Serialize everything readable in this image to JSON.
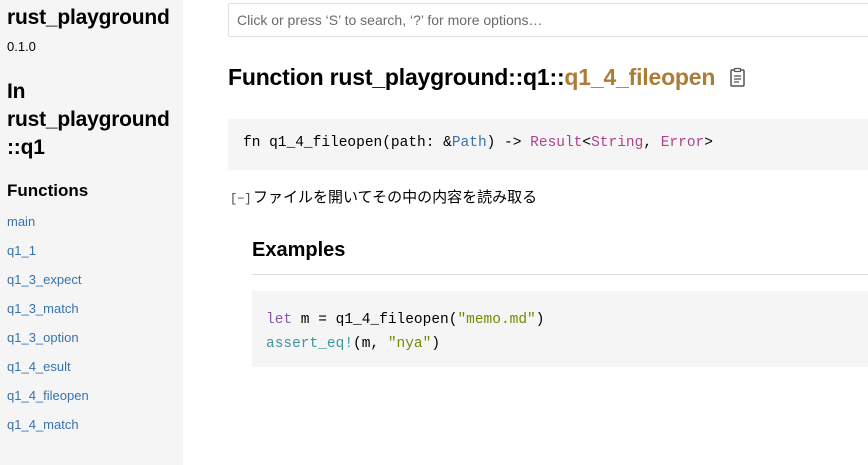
{
  "sidebar": {
    "crate_name": "rust_playground",
    "version": "0.1.0",
    "in_label": "In",
    "in_module_line1": "rust_playground",
    "in_module_line2": "::q1",
    "functions_heading": "Functions",
    "functions": [
      "main",
      "q1_1",
      "q1_3_expect",
      "q1_3_match",
      "q1_3_option",
      "q1_4_esult",
      "q1_4_fileopen",
      "q1_4_match"
    ]
  },
  "search": {
    "placeholder": "Click or press ‘S’ to search, ‘?’ for more options…"
  },
  "main": {
    "title_prefix": "Function rust_playground::q1::",
    "title_fn": "q1_4_fileopen",
    "signature": {
      "fn_kw": "fn q1_4_fileopen(path: &",
      "path_type": "Path",
      "arrow": ") -> ",
      "result_type": "Result",
      "lt": "<",
      "string_type": "String",
      "comma": ", ",
      "error_type": "Error",
      "gt": ">"
    },
    "toggle_label": "[−]",
    "description": "ファイルを開いてその中の内容を読み取る",
    "examples_heading": "Examples",
    "example": {
      "line1_kw": "let",
      "line1_mid": " m = q1_4_fileopen(",
      "line1_str": "\"memo.md\"",
      "line1_end": ")",
      "line2_macro": "assert_eq!",
      "line2_mid": "(m, ",
      "line2_str": "\"nya\"",
      "line2_end": ")"
    }
  },
  "colors": {
    "link": "#3873ad",
    "fn_name": "#ad7c37",
    "type": "#ad448e",
    "keyword": "#8959a8",
    "string": "#718c00",
    "macro": "#3e999f",
    "sidebar_bg": "#f5f5f5"
  },
  "icons": {
    "copy": "clipboard-icon"
  }
}
